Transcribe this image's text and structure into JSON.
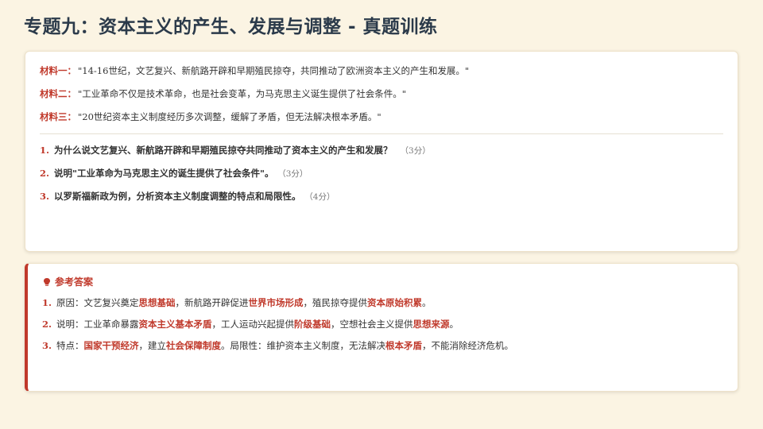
{
  "title": "专题九：资本主义的产生、发展与调整 - 真题训练",
  "materials": [
    {
      "label": "材料一：",
      "text": "\"14-16世纪，文艺复兴、新航路开辟和早期殖民掠夺，共同推动了欧洲资本主义的产生和发展。\""
    },
    {
      "label": "材料二：",
      "text": "\"工业革命不仅是技术革命，也是社会变革，为马克思主义诞生提供了社会条件。\""
    },
    {
      "label": "材料三：",
      "text": "\"20世纪资本主义制度经历多次调整，缓解了矛盾，但无法解决根本矛盾。\""
    }
  ],
  "questions": [
    {
      "num": "1.",
      "text": "为什么说文艺复兴、新航路开辟和早期殖民掠夺共同推动了资本主义的产生和发展？",
      "score": "（3分）"
    },
    {
      "num": "2.",
      "text": "说明\"工业革命为马克思主义的诞生提供了社会条件\"。",
      "score": "（3分）"
    },
    {
      "num": "3.",
      "text": "以罗斯福新政为例，分析资本主义制度调整的特点和局限性。",
      "score": "（4分）"
    }
  ],
  "answers": {
    "heading": "参考答案",
    "items": [
      {
        "num": "1.",
        "parts": [
          {
            "t": "原因：文艺复兴奠定"
          },
          {
            "t": "思想基础",
            "hl": true
          },
          {
            "t": "，新航路开辟促进"
          },
          {
            "t": "世界市场形成",
            "hl": true
          },
          {
            "t": "，殖民掠夺提供"
          },
          {
            "t": "资本原始积累",
            "hl": true
          },
          {
            "t": "。"
          }
        ]
      },
      {
        "num": "2.",
        "parts": [
          {
            "t": "说明：工业革命暴露"
          },
          {
            "t": "资本主义基本矛盾",
            "hl": true
          },
          {
            "t": "，工人运动兴起提供"
          },
          {
            "t": "阶级基础",
            "hl": true
          },
          {
            "t": "，空想社会主义提供"
          },
          {
            "t": "思想来源",
            "hl": true
          },
          {
            "t": "。"
          }
        ]
      },
      {
        "num": "3.",
        "parts": [
          {
            "t": "特点："
          },
          {
            "t": "国家干预经济",
            "hl": true
          },
          {
            "t": "，建立"
          },
          {
            "t": "社会保障制度",
            "hl": true
          },
          {
            "t": "。局限性：维护资本主义制度，无法解决"
          },
          {
            "t": "根本矛盾",
            "hl": true
          },
          {
            "t": "，不能消除经济危机。"
          }
        ]
      }
    ]
  }
}
